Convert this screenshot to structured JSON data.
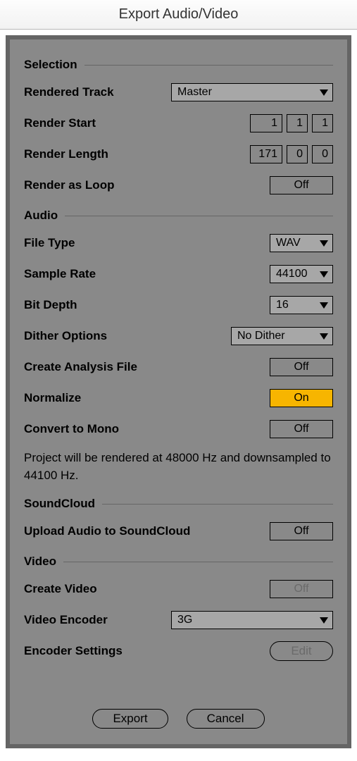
{
  "window": {
    "title": "Export Audio/Video"
  },
  "sections": {
    "selection": {
      "title": "Selection"
    },
    "audio": {
      "title": "Audio"
    },
    "soundcloud": {
      "title": "SoundCloud"
    },
    "video": {
      "title": "Video"
    }
  },
  "selection": {
    "rendered_track": {
      "label": "Rendered Track",
      "value": "Master"
    },
    "render_start": {
      "label": "Render Start",
      "bars": "1",
      "beats": "1",
      "sixteenths": "1"
    },
    "render_length": {
      "label": "Render Length",
      "bars": "171",
      "beats": "0",
      "sixteenths": "0"
    },
    "render_as_loop": {
      "label": "Render as Loop",
      "value": "Off"
    }
  },
  "audio": {
    "file_type": {
      "label": "File Type",
      "value": "WAV"
    },
    "sample_rate": {
      "label": "Sample Rate",
      "value": "44100"
    },
    "bit_depth": {
      "label": "Bit Depth",
      "value": "16"
    },
    "dither": {
      "label": "Dither Options",
      "value": "No Dither"
    },
    "analysis": {
      "label": "Create Analysis File",
      "value": "Off"
    },
    "normalize": {
      "label": "Normalize",
      "value": "On"
    },
    "mono": {
      "label": "Convert to Mono",
      "value": "Off"
    },
    "note": "Project will be rendered at 48000 Hz and downsampled to 44100 Hz."
  },
  "soundcloud": {
    "upload": {
      "label": "Upload Audio to SoundCloud",
      "value": "Off"
    }
  },
  "video": {
    "create": {
      "label": "Create Video",
      "value": "Off"
    },
    "encoder": {
      "label": "Video Encoder",
      "value": "3G"
    },
    "settings": {
      "label": "Encoder Settings",
      "button": "Edit"
    }
  },
  "buttons": {
    "export": "Export",
    "cancel": "Cancel"
  }
}
